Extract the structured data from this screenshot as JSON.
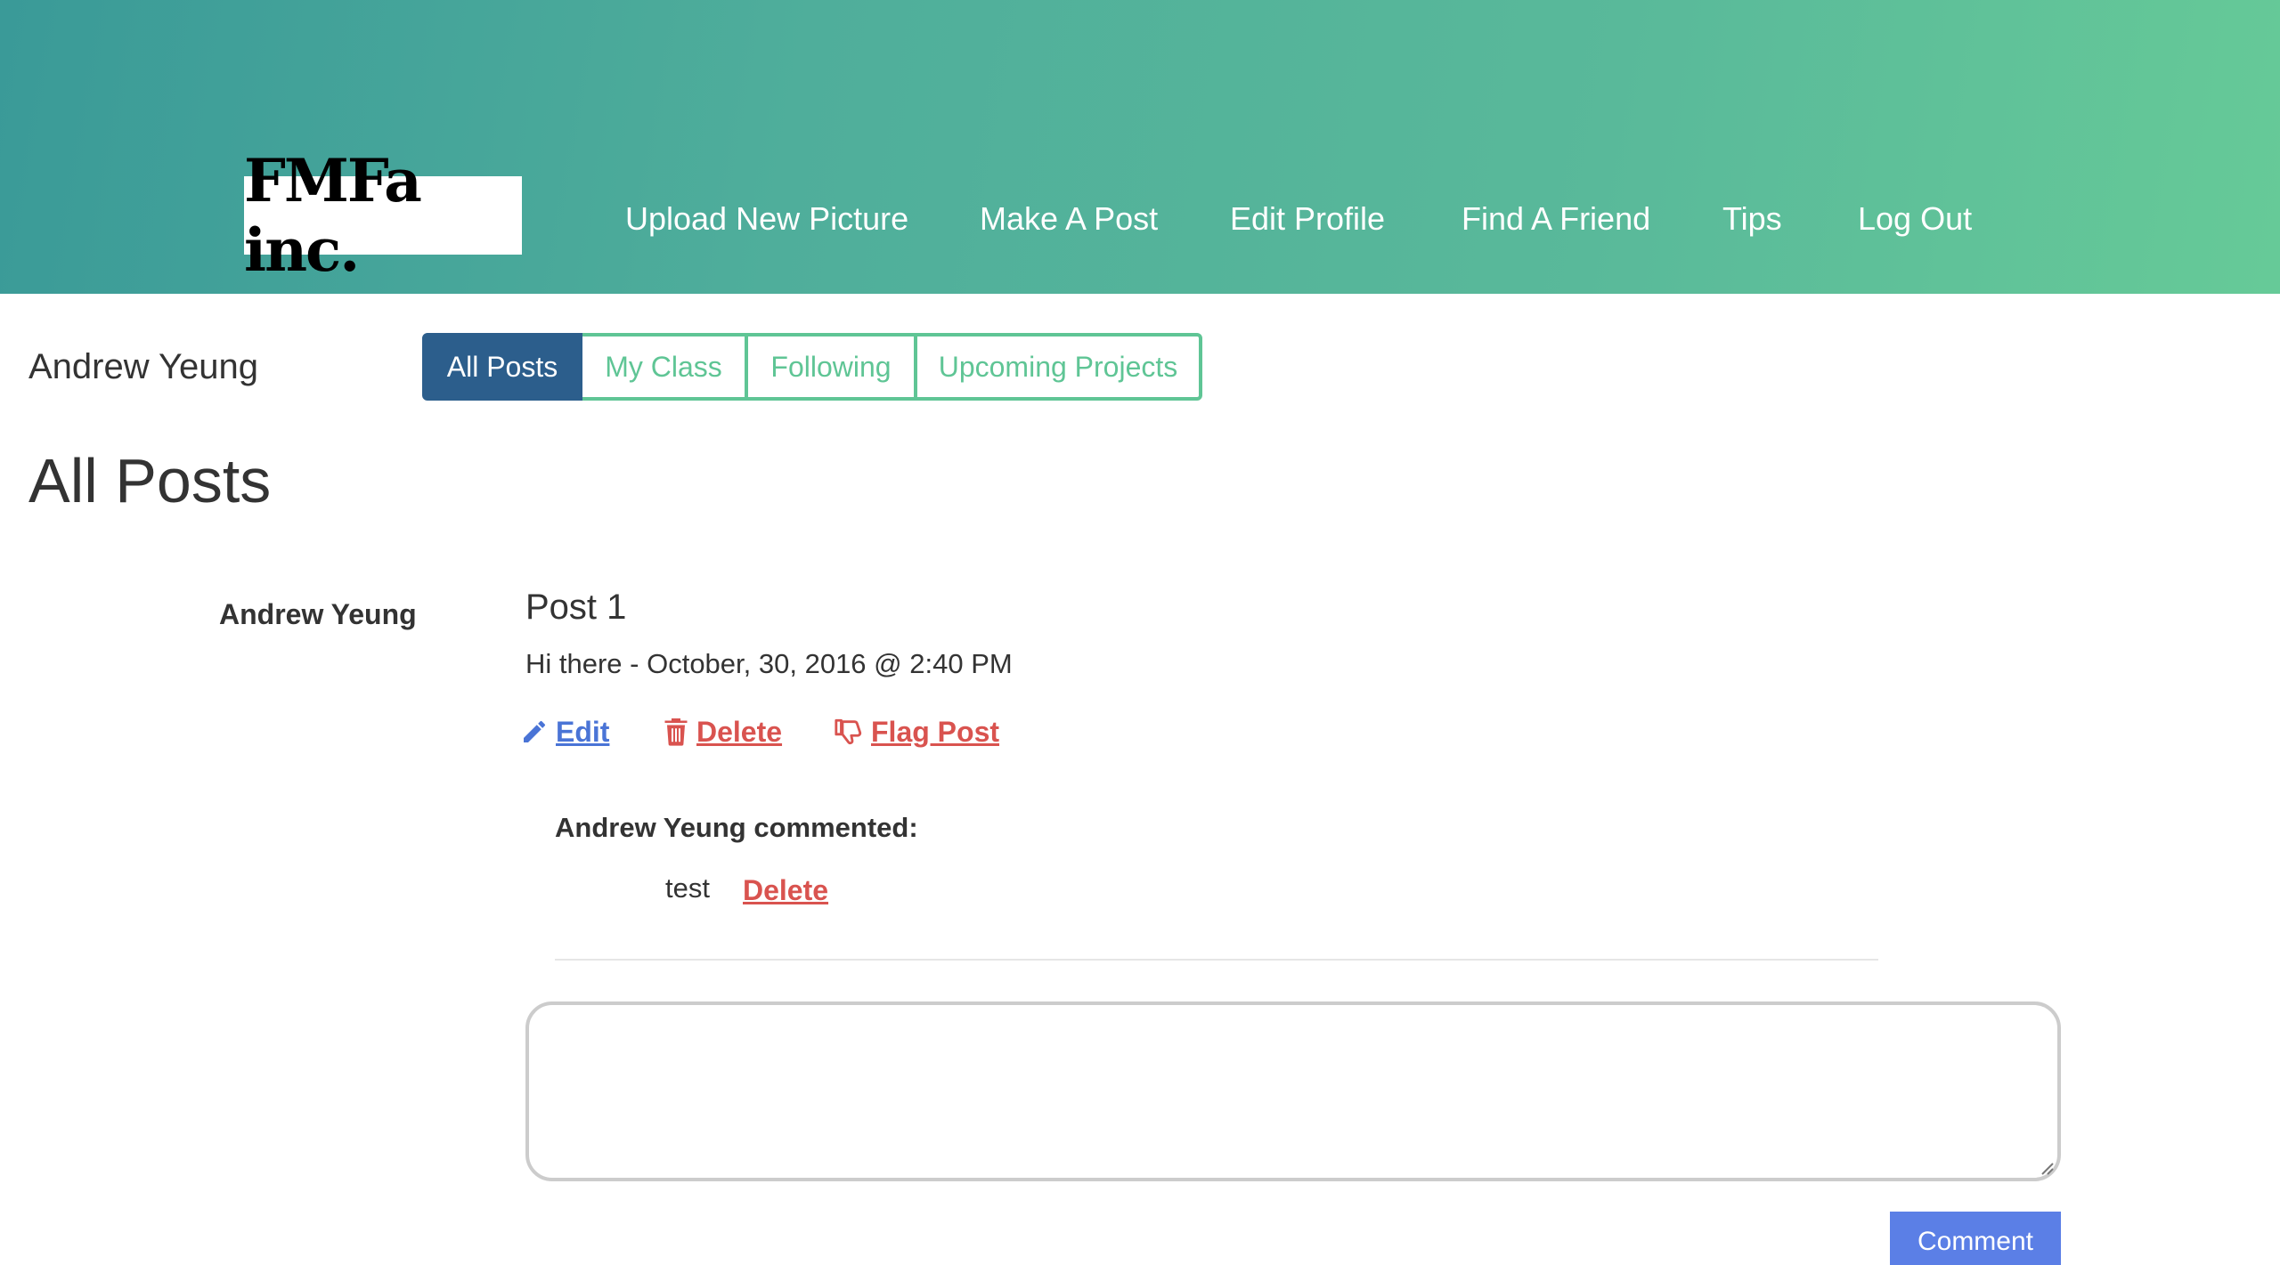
{
  "header": {
    "logo_text": "FMFa inc.",
    "nav": [
      {
        "label": "Upload New Picture"
      },
      {
        "label": "Make A Post"
      },
      {
        "label": "Edit Profile"
      },
      {
        "label": "Find A Friend"
      },
      {
        "label": "Tips"
      },
      {
        "label": "Log Out"
      }
    ],
    "gradient_colors": [
      "#3a9a98",
      "#66ca98"
    ]
  },
  "sidebar": {
    "user_name": "Andrew Yeung"
  },
  "tabs": [
    {
      "label": "All Posts",
      "active": true
    },
    {
      "label": "My Class",
      "active": false
    },
    {
      "label": "Following",
      "active": false
    },
    {
      "label": "Upcoming Projects",
      "active": false
    }
  ],
  "main": {
    "title": "All Posts",
    "post": {
      "author": "Andrew Yeung",
      "title": "Post 1",
      "body": "Hi there - October, 30, 2016 @ 2:40 PM",
      "actions": {
        "edit": "Edit",
        "delete": "Delete",
        "flag": "Flag Post"
      },
      "comments": [
        {
          "header": "Andrew Yeung commented:",
          "text": "test",
          "delete_label": "Delete"
        }
      ]
    },
    "comment_form": {
      "value": "",
      "button_label": "Comment"
    }
  },
  "colors": {
    "accent_green": "#5fc595",
    "active_tab": "#2c5e8c",
    "edit_blue": "#4a74d6",
    "delete_red": "#d9534f",
    "comment_button": "#5b7fe6"
  },
  "icons": {
    "edit": "pencil-icon",
    "delete": "trash-icon",
    "flag": "thumbs-down-icon"
  }
}
